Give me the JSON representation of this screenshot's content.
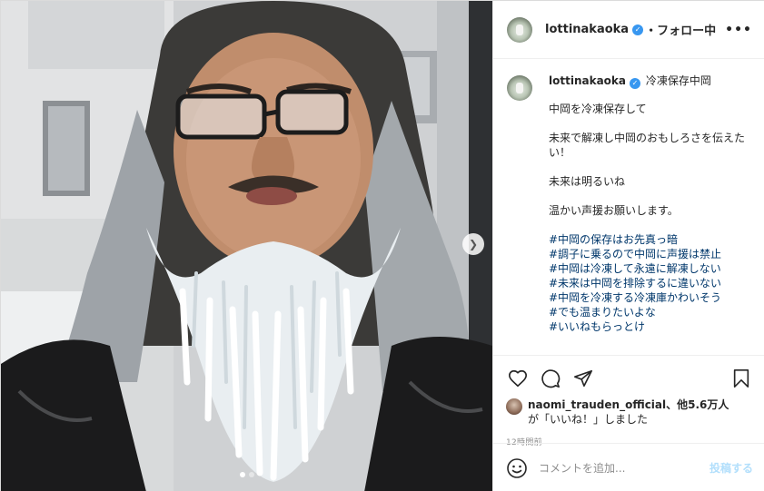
{
  "photo": {
    "description_icon": "photo-icon",
    "next_icon": "chevron-right-icon"
  },
  "header": {
    "username": "lottinakaoka",
    "verified_icon": "verified-badge-icon",
    "follow_label": "・フォロー中",
    "more_icon": "more-options-icon",
    "more_label": "•••"
  },
  "caption": {
    "username": "lottinakaoka",
    "title": "冷凍保存中岡",
    "lines": [
      "中岡を冷凍保存して",
      "",
      "未来で解凍し中岡のおもしろさを伝えたい！",
      "",
      "未来は明るいね",
      "",
      "温かい声援お願いします。",
      ""
    ],
    "hashtags": [
      "#中岡の保存はお先真っ暗",
      "#調子に乗るので中岡に声援は禁止",
      "#中岡は冷凍して永遠に解凍しない",
      "#未来は中岡を排除するに違いない",
      "#中岡を冷凍する冷凍庫かわいそう",
      "#でも温まりたいよな",
      "#いいねもらっとけ"
    ]
  },
  "actions": {
    "like_icon": "heart-icon",
    "comment_icon": "comment-icon",
    "share_icon": "share-icon",
    "save_icon": "bookmark-icon"
  },
  "likes": {
    "user": "naomi_trauden_official",
    "others": "、他5.6万人",
    "suffix": "が「いいね！」しました"
  },
  "timestamp": "12時間前",
  "comment": {
    "emoji_icon": "emoji-icon",
    "placeholder": "コメントを追加...",
    "post_label": "投稿する"
  },
  "colors": {
    "text": "#262626",
    "secondary": "#8e8e8e",
    "hashtag": "#00376b",
    "verified": "#3897f0",
    "post_disabled": "#b2dffc",
    "border": "#dbdbdb"
  }
}
